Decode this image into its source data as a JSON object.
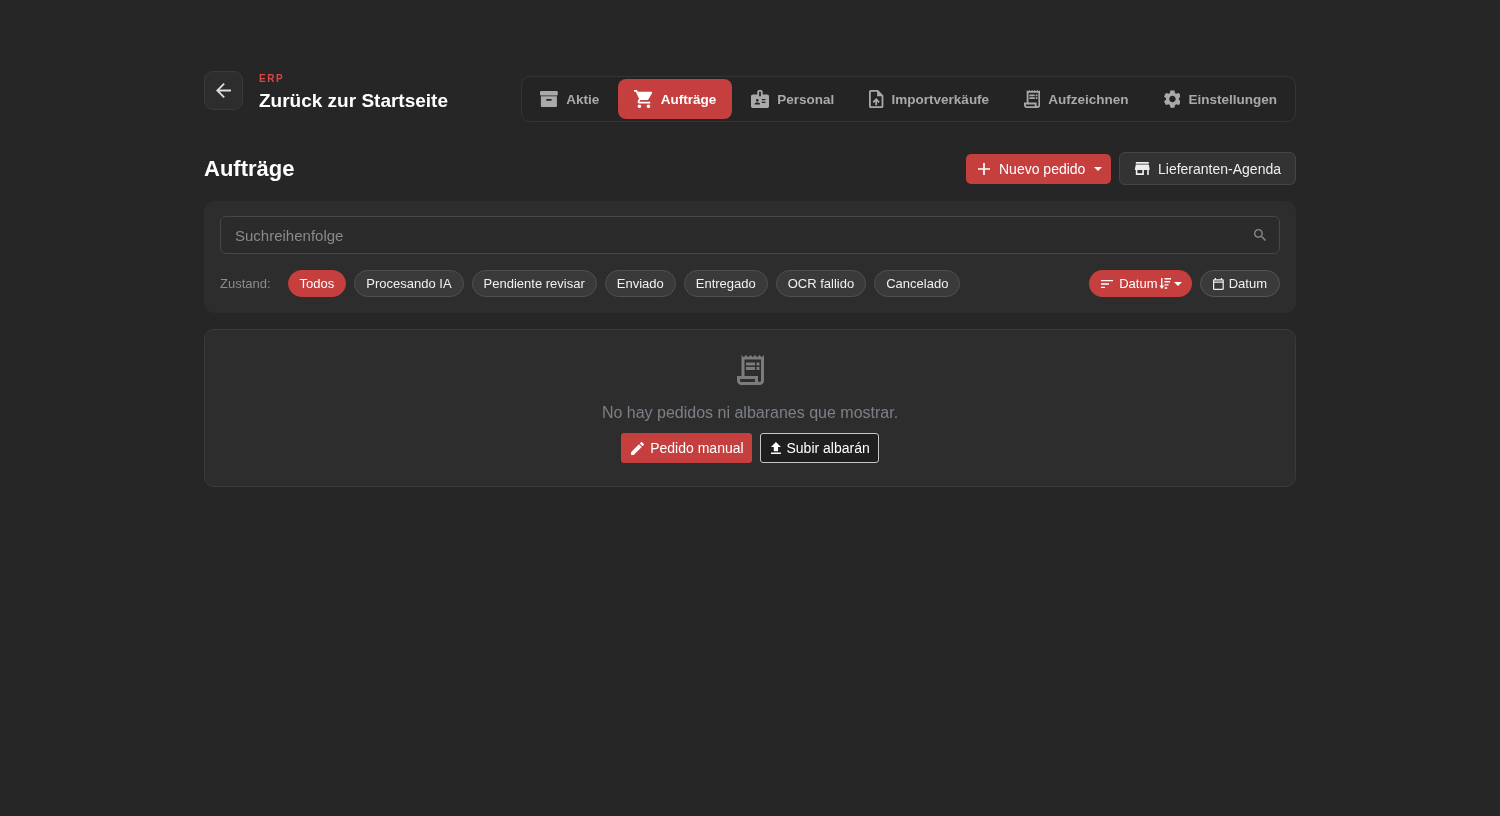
{
  "header": {
    "brand": "ERP",
    "title": "Zurück zur Startseite"
  },
  "nav_tabs": [
    {
      "label": "Aktie",
      "selected": false
    },
    {
      "label": "Aufträge",
      "selected": true
    },
    {
      "label": "Personal",
      "selected": false
    },
    {
      "label": "Importverkäufe",
      "selected": false
    },
    {
      "label": "Aufzeichnen",
      "selected": false
    },
    {
      "label": "Einstellungen",
      "selected": false
    }
  ],
  "page": {
    "title": "Aufträge",
    "actions": [
      {
        "label": "Nuevo pedido",
        "kind": "primary"
      },
      {
        "label": "Lieferanten-Agenda",
        "kind": "secondary"
      }
    ]
  },
  "filters": {
    "search": {
      "placeholder": "Suchreihenfolge"
    },
    "status_label": "Zustand:",
    "statuses": [
      {
        "label": "Todos",
        "selected": true
      },
      {
        "label": "Procesando IA",
        "selected": false
      },
      {
        "label": "Pendiente revisar",
        "selected": false
      },
      {
        "label": "Enviado",
        "selected": false
      },
      {
        "label": "Entregado",
        "selected": false
      },
      {
        "label": "OCR fallido",
        "selected": false
      },
      {
        "label": "Cancelado",
        "selected": false
      }
    ],
    "sort_button": {
      "label": "Datum"
    },
    "date_button": {
      "label": "Datum"
    }
  },
  "empty_state": {
    "message": "No hay pedidos ni albaranes que mostrar.",
    "actions": [
      {
        "label": "Pedido manual",
        "kind": "primary"
      },
      {
        "label": "Subir albarán",
        "kind": "outline"
      }
    ]
  }
}
